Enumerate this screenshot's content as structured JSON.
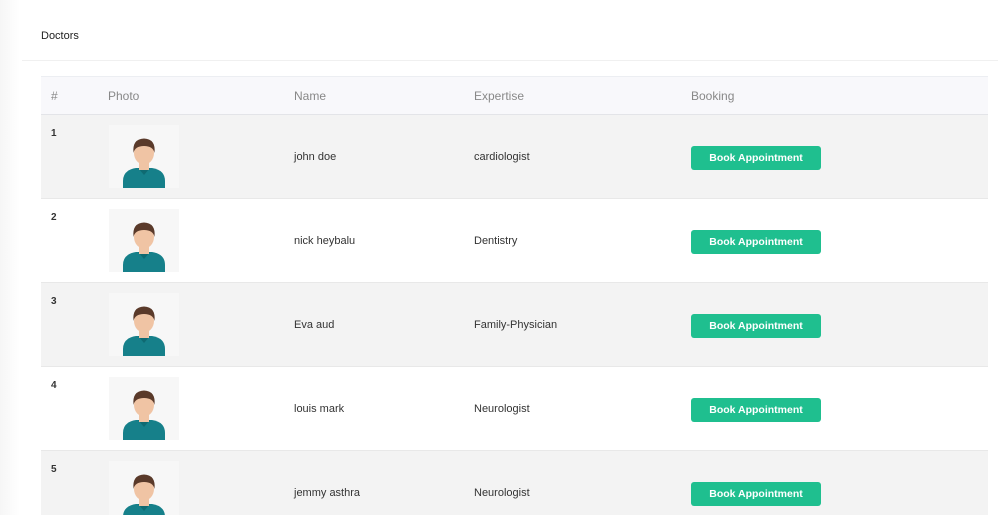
{
  "card": {
    "title": "Doctors"
  },
  "table": {
    "headers": {
      "num": "#",
      "photo": "Photo",
      "name": "Name",
      "expertise": "Expertise",
      "booking": "Booking"
    },
    "rows": [
      {
        "num": "1",
        "name": "john doe",
        "expertise": "cardiologist",
        "photo_icon": "doctor-avatar-icon",
        "booking_label": "Book Appointment"
      },
      {
        "num": "2",
        "name": "nick heybalu",
        "expertise": "Dentistry",
        "photo_icon": "doctor-avatar-icon",
        "booking_label": "Book Appointment"
      },
      {
        "num": "3",
        "name": "Eva aud",
        "expertise": "Family-Physician",
        "photo_icon": "doctor-avatar-icon",
        "booking_label": "Book Appointment"
      },
      {
        "num": "4",
        "name": "louis mark",
        "expertise": "Neurologist",
        "photo_icon": "doctor-avatar-icon",
        "booking_label": "Book Appointment"
      },
      {
        "num": "5",
        "name": "jemmy asthra",
        "expertise": "Neurologist",
        "photo_icon": "doctor-avatar-icon",
        "booking_label": "Book Appointment"
      }
    ]
  },
  "colors": {
    "button": "#1fbf8f",
    "avatar_shirt": "#16808a",
    "avatar_hair": "#5a3a2a",
    "avatar_skin": "#f0c4a4"
  }
}
